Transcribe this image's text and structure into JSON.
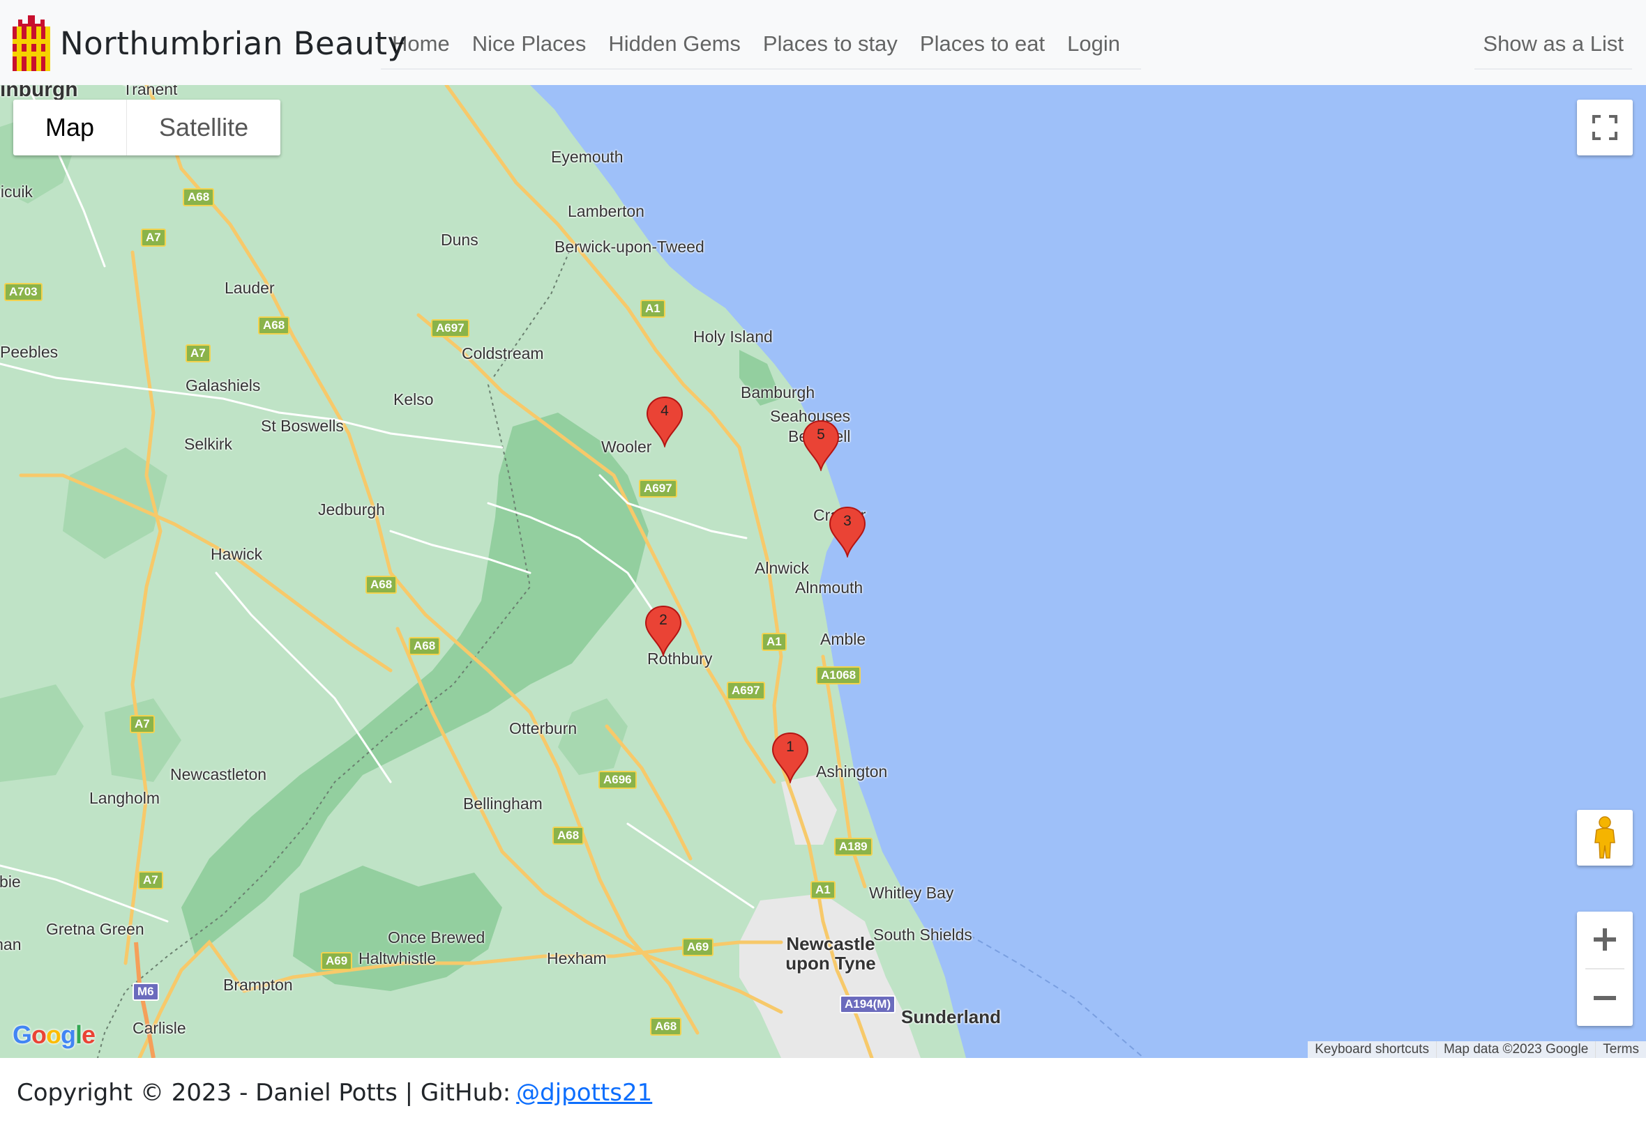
{
  "brand": {
    "name": "Northumbrian Beauty"
  },
  "nav": {
    "items": [
      {
        "label": "Home"
      },
      {
        "label": "Nice Places"
      },
      {
        "label": "Hidden Gems"
      },
      {
        "label": "Places to stay"
      },
      {
        "label": "Places to eat"
      },
      {
        "label": "Login"
      }
    ],
    "right_label": "Show as a List"
  },
  "map": {
    "type_control": {
      "map_label": "Map",
      "satellite_label": "Satellite",
      "selected": "Map"
    },
    "places": [
      "inburgh",
      "Tranent",
      "Eyemouth",
      "Lamberton",
      "Berwick-upon-Tweed",
      "Duns",
      "Penicuik",
      "Lauder",
      "Peebles",
      "Galashiels",
      "Coldstream",
      "Kelso",
      "St Boswells",
      "Selkirk",
      "Holy Island",
      "Bamburgh",
      "Seahouses",
      "Beadnell",
      "Wooler",
      "Craster",
      "Jedburgh",
      "Hawick",
      "Alnwick",
      "Alnmouth",
      "Amble",
      "Rothbury",
      "Otterburn",
      "Ashington",
      "Newcastleton",
      "Langholm",
      "Bellingham",
      "Whitley Bay",
      "Gretna Green",
      "Once Brewed",
      "Haltwhistle",
      "Hexham",
      "Newcastle upon Tyne",
      "South Shields",
      "Brampton",
      "Sunderland",
      "Carlisle",
      "Lockerbie",
      "Annan"
    ],
    "roads": [
      "A68",
      "A7",
      "A703",
      "A68",
      "A697",
      "A7",
      "A1",
      "A697",
      "A68",
      "A68",
      "A1",
      "A697",
      "A1068",
      "A7",
      "A696",
      "A68",
      "A189",
      "A7",
      "A1",
      "A69",
      "A69",
      "M6",
      "A194(M)",
      "A68"
    ],
    "markers": [
      "1",
      "2",
      "3",
      "4",
      "5"
    ],
    "logo": "Google",
    "attribution": [
      "Keyboard shortcuts",
      "Map data ©2023 Google",
      "Terms"
    ],
    "controls": {
      "fullscreen_icon": "fullscreen-icon",
      "pegman_icon": "pegman-icon",
      "zoom_in": "+",
      "zoom_out": "−"
    }
  },
  "footer": {
    "text": "Copyright © 2023 - Daniel Potts | GitHub:",
    "link_label": "@djpotts21"
  },
  "colors": {
    "water": "#9ec0f9",
    "land": "#bfe3c6",
    "forest": "#93cf9f",
    "marker": "#ea4335",
    "link": "#0d6efd"
  }
}
